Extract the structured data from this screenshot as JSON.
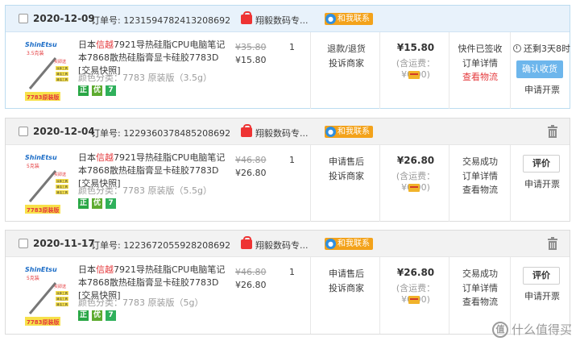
{
  "orders": [
    {
      "date": "2020-12-09",
      "order_no": "订单号: 1231594782413208692",
      "shop": "翔毅数码专...",
      "contact": "和我联系",
      "product": {
        "pre": "日本",
        "hl": "信越",
        "rest": "7921导热硅脂CPU电脑笔记本7868散热硅脂膏显卡硅胶7783D [交易快照]",
        "spec": "颜色分类：7783 原装版（3.5g）",
        "thumb_size": "3.5克装"
      },
      "orig_price": "¥35.80",
      "price": "¥15.80",
      "qty": "1",
      "service": [
        "退款/退货",
        "投诉商家"
      ],
      "total": "¥15.80",
      "shipping": "(含运费：¥0.00)",
      "status": [
        "快件已签收",
        "订单详情",
        "查看物流"
      ],
      "remain": "还剩3天8时",
      "confirm_label": "确认收货",
      "invoice": "申请开票"
    },
    {
      "date": "2020-12-04",
      "order_no": "订单号: 1229360378485208692",
      "shop": "翔毅数码专...",
      "contact": "和我联系",
      "product": {
        "pre": "日本",
        "hl": "信越",
        "rest": "7921导热硅脂CPU电脑笔记本7868散热硅脂膏显卡硅胶7783D [交易快照]",
        "spec": "颜色分类：7783 原装版（5.5g）",
        "thumb_size": "5克装"
      },
      "orig_price": "¥46.80",
      "price": "¥26.80",
      "qty": "1",
      "service": [
        "申请售后",
        "投诉商家"
      ],
      "total": "¥26.80",
      "shipping": "(含运费：¥0.00)",
      "status": [
        "交易成功",
        "订单详情",
        "查看物流"
      ],
      "eval_label": "评价",
      "invoice": "申请开票"
    },
    {
      "date": "2020-11-17",
      "order_no": "订单号: 1223672055928208692",
      "shop": "翔毅数码专...",
      "contact": "和我联系",
      "product": {
        "pre": "日本",
        "hl": "信越",
        "rest": "7921导热硅脂CPU电脑笔记本7868散热硅脂膏显卡硅胶7783D [交易快照]",
        "spec": "颜色分类：7783 原装版（5g）",
        "thumb_size": "5克装"
      },
      "orig_price": "¥46.80",
      "price": "¥26.80",
      "qty": "1",
      "service": [
        "申请售后",
        "投诉商家"
      ],
      "total": "¥26.80",
      "shipping": "(含运费：¥0.00)",
      "status": [
        "交易成功",
        "订单详情",
        "查看物流"
      ],
      "eval_label": "评价",
      "invoice": "申请开票"
    }
  ],
  "thumb": {
    "brand": "ShinEtsu",
    "badge": "买即送",
    "model": "7783原装版",
    "lines": [
      "涂抹工具",
      "清洁工具",
      "清洁工具"
    ]
  },
  "badges": [
    "正",
    "优",
    "7"
  ],
  "watermark": "什么值得买",
  "colors": {
    "accent_blue": "#6db6ec",
    "price_red": "#e4393c",
    "contact_orange": "#f3a21a"
  }
}
